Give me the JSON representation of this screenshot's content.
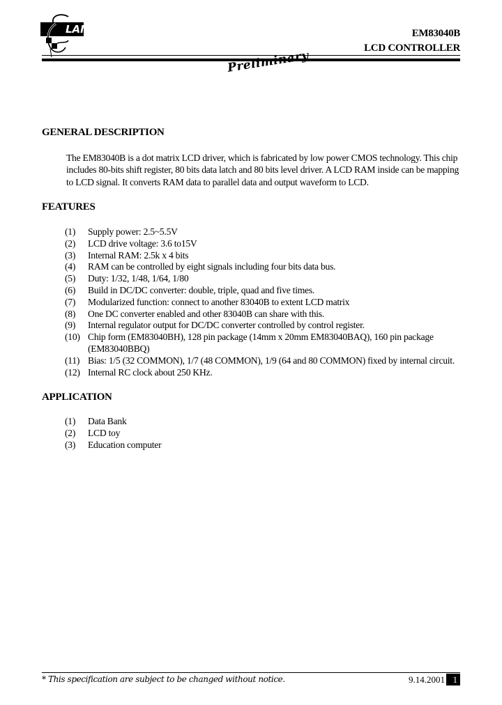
{
  "header": {
    "logo_text": "LAN",
    "logo_icon": "elan-logo-icon",
    "part_number": "EM83040B",
    "product_type": "LCD CONTROLLER",
    "stamp": "Preliminary"
  },
  "sections": {
    "general_description": {
      "title": "GENERAL DESCRIPTION",
      "text": "The EM83040B is a dot matrix LCD driver, which is fabricated by low power CMOS technology. This chip includes 80-bits shift register, 80 bits data latch and 80 bits level driver. A LCD RAM inside can be mapping to LCD signal. It converts RAM data to parallel data and output waveform to LCD."
    },
    "features": {
      "title": "FEATURES",
      "items": [
        {
          "num": "(1)",
          "text": "Supply power: 2.5~5.5V"
        },
        {
          "num": "(2)",
          "text": "LCD drive voltage: 3.6 to15V"
        },
        {
          "num": "(3)",
          "text": "Internal RAM: 2.5k x 4 bits"
        },
        {
          "num": "(4)",
          "text": "RAM can be controlled by eight signals including four bits data bus."
        },
        {
          "num": "(5)",
          "text": "Duty: 1/32, 1/48, 1/64, 1/80"
        },
        {
          "num": "(6)",
          "text": "Build in DC/DC converter: double, triple, quad and five times."
        },
        {
          "num": "(7)",
          "text": "Modularized function: connect to another 83040B to extent LCD matrix"
        },
        {
          "num": "(8)",
          "text": "One DC converter enabled and other 83040B can share with this."
        },
        {
          "num": "(9)",
          "text": "Internal regulator output for DC/DC converter controlled by control register."
        },
        {
          "num": "(10)",
          "text": "Chip form (EM83040BH), 128 pin package (14mm x 20mm EM83040BAQ), 160 pin package (EM83040BBQ)"
        },
        {
          "num": "(11)",
          "text": "Bias: 1/5 (32 COMMON), 1/7 (48 COMMON), 1/9 (64 and 80 COMMON) fixed by internal circuit."
        },
        {
          "num": "(12)",
          "text": "Internal RC clock about 250 KHz."
        }
      ]
    },
    "application": {
      "title": "APPLICATION",
      "items": [
        {
          "num": "(1)",
          "text": "Data Bank"
        },
        {
          "num": "(2)",
          "text": "LCD toy"
        },
        {
          "num": "(3)",
          "text": "Education computer"
        }
      ]
    }
  },
  "footer": {
    "note": "* This specification are subject to be changed without notice.",
    "date": "9.14.2001",
    "page_number": "1"
  }
}
